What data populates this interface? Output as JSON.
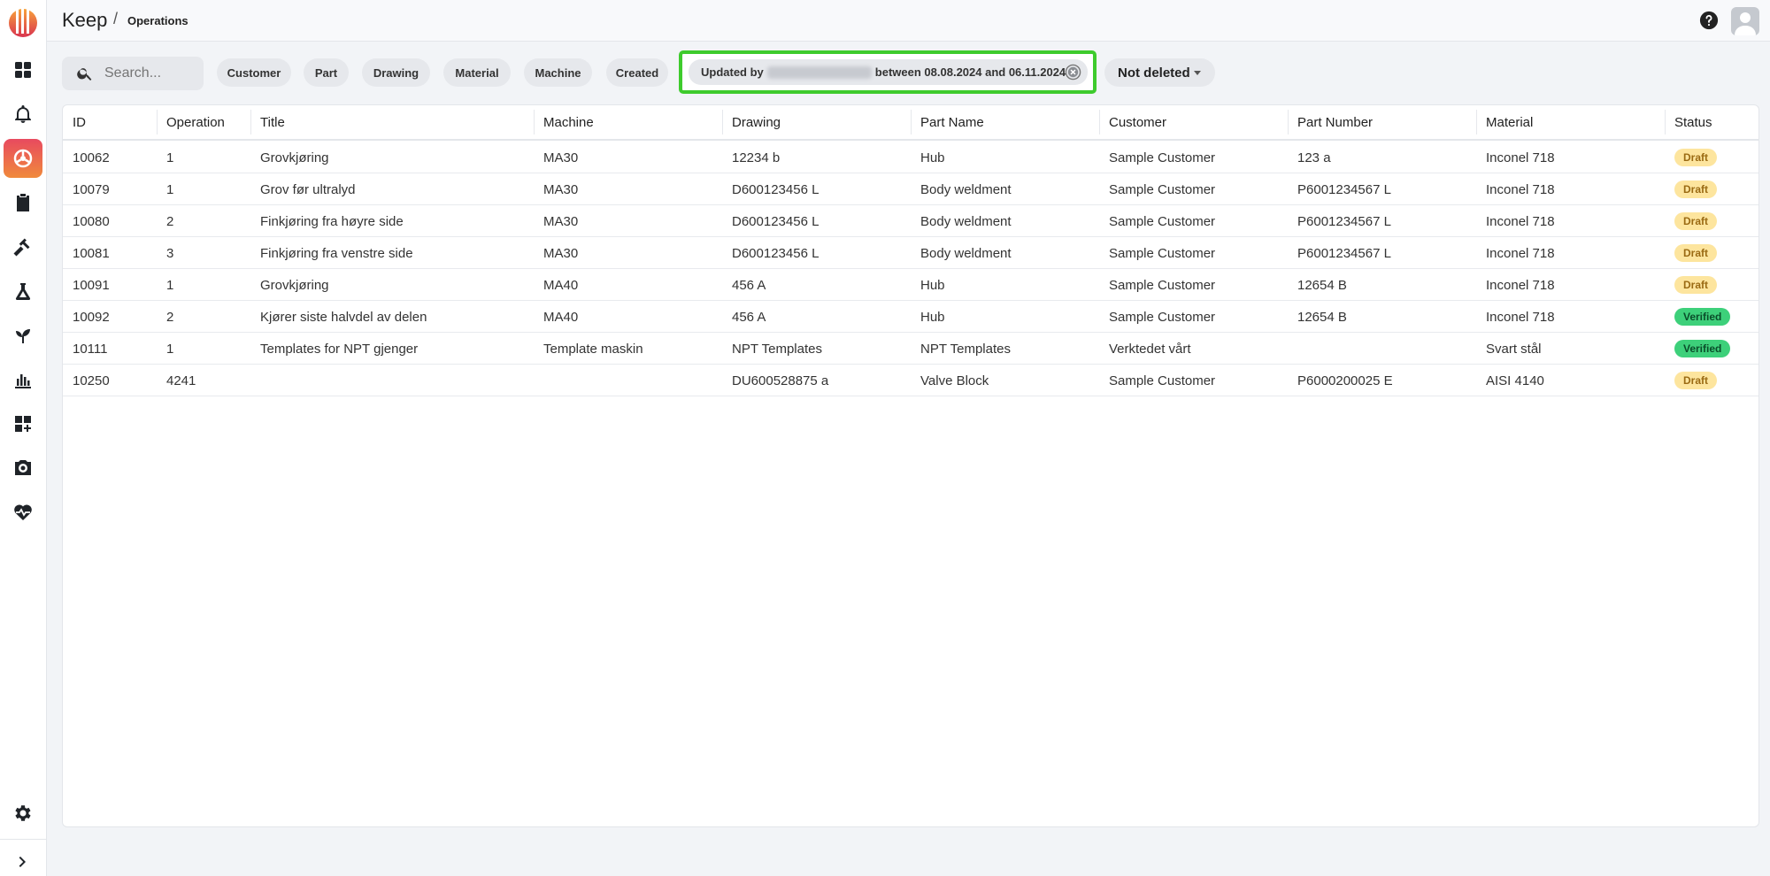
{
  "app": {
    "brand": "Keep",
    "breadcrumb": "Operations"
  },
  "sidebar": {
    "items": [
      {
        "icon": "dashboard-icon"
      },
      {
        "icon": "bell-icon"
      },
      {
        "icon": "operations-icon",
        "active": true
      },
      {
        "icon": "clipboard-icon"
      },
      {
        "icon": "tools-icon"
      },
      {
        "icon": "flask-icon"
      },
      {
        "icon": "sprout-icon"
      },
      {
        "icon": "chart-icon"
      },
      {
        "icon": "add-widget-icon"
      },
      {
        "icon": "camera-icon"
      },
      {
        "icon": "heart-pulse-icon"
      }
    ],
    "settings_icon": "gear-icon",
    "expand_icon": "chevron-right-icon"
  },
  "filters": {
    "search_placeholder": "Search...",
    "chips": [
      "Customer",
      "Part",
      "Drawing",
      "Material",
      "Machine",
      "Created"
    ],
    "active_filter": {
      "prefix": "Updated by",
      "suffix": "between 08.08.2024 and 06.11.2024"
    },
    "deleted_dropdown": "Not deleted"
  },
  "table": {
    "columns": [
      "ID",
      "Operation",
      "Title",
      "Machine",
      "Drawing",
      "Part Name",
      "Customer",
      "Part Number",
      "Material",
      "Status"
    ],
    "rows": [
      [
        "10062",
        "1",
        "Grovkjøring",
        "MA30",
        "12234 b",
        "Hub",
        "Sample Customer",
        "123 a",
        "Inconel 718",
        "Draft"
      ],
      [
        "10079",
        "1",
        "Grov før ultralyd",
        "MA30",
        "D600123456 L",
        "Body weldment",
        "Sample Customer",
        "P6001234567 L",
        "Inconel 718",
        "Draft"
      ],
      [
        "10080",
        "2",
        "Finkjøring fra høyre side",
        "MA30",
        "D600123456 L",
        "Body weldment",
        "Sample Customer",
        "P6001234567 L",
        "Inconel 718",
        "Draft"
      ],
      [
        "10081",
        "3",
        "Finkjøring fra venstre side",
        "MA30",
        "D600123456 L",
        "Body weldment",
        "Sample Customer",
        "P6001234567 L",
        "Inconel 718",
        "Draft"
      ],
      [
        "10091",
        "1",
        "Grovkjøring",
        "MA40",
        "456 A",
        "Hub",
        "Sample Customer",
        "12654 B",
        "Inconel 718",
        "Draft"
      ],
      [
        "10092",
        "2",
        "Kjører siste halvdel av delen",
        "MA40",
        "456 A",
        "Hub",
        "Sample Customer",
        "12654 B",
        "Inconel 718",
        "Verified"
      ],
      [
        "10111",
        "1",
        "Templates for NPT gjenger",
        "Template maskin",
        "NPT Templates",
        "NPT Templates",
        "Verktedet vårt",
        "",
        "Svart stål",
        "Verified"
      ],
      [
        "10250",
        "4241",
        "",
        "",
        "DU600528875 a",
        "Valve Block",
        "Sample Customer",
        "P6000200025 E",
        "AISI 4140",
        "Draft"
      ]
    ]
  },
  "colors": {
    "accent_start": "#e84a5f",
    "accent_end": "#f08a3c",
    "highlight_border": "#3ecb2d",
    "draft": "#fde59e",
    "verified": "#3dd07a"
  }
}
